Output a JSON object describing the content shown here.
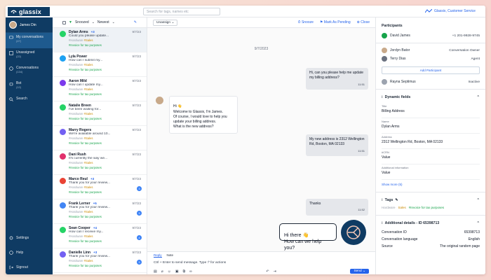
{
  "app": {
    "name": "glassix",
    "account": "Glassix, Customer Service"
  },
  "search": {
    "placeholder": "Search for tags, names etc"
  },
  "sidebar": {
    "user": "James Din",
    "items": [
      {
        "label": "My conversations",
        "count": "(47)"
      },
      {
        "label": "Unassigned",
        "count": "(22)"
      },
      {
        "label": "Conversations",
        "count": "(134)"
      },
      {
        "label": "Bot",
        "count": "(12)"
      },
      {
        "label": "Search",
        "count": ""
      }
    ],
    "bottom": [
      {
        "label": "Settings"
      },
      {
        "label": "Help"
      },
      {
        "label": "Signout"
      }
    ]
  },
  "list": {
    "filter": "Snoozed",
    "sort": "Newest",
    "conversations": [
      {
        "name": "Dylan Arms",
        "plus": "+3",
        "date": "9/7/23",
        "preview": "Could you please update...",
        "tags": [
          "#Hardware",
          "#Sales",
          "#Invoice for tax purposes"
        ],
        "channel": "whatsapp",
        "color": "#25d366",
        "badge": ""
      },
      {
        "name": "Lyla Power",
        "plus": "",
        "date": "9/7/23",
        "preview": "How can I submit my...",
        "tags": [
          "#Hardware",
          "#Sales",
          "#Invoice for tax purposes"
        ],
        "channel": "twitter",
        "color": "#1da1f2",
        "badge": ""
      },
      {
        "name": "Aaron Mild",
        "plus": "",
        "date": "9/7/23",
        "preview": "How can I update my...",
        "tags": [
          "#Hardware",
          "#Sales",
          "#Invoice for tax purposes"
        ],
        "channel": "messenger",
        "color": "#7c3aed",
        "badge": ""
      },
      {
        "name": "Natalie Breen",
        "plus": "",
        "date": "9/7/23",
        "preview": "I've been waiting for...",
        "tags": [
          "#Hardware",
          "#Sales",
          "#Invoice for tax purposes"
        ],
        "channel": "whatsapp",
        "color": "#25d366",
        "badge": ""
      },
      {
        "name": "Marry Rogers",
        "plus": "",
        "date": "9/7/23",
        "preview": "We're available around 10...",
        "tags": [
          "#Hardware",
          "#Sales",
          "#Invoice for tax purposes"
        ],
        "channel": "viber",
        "color": "#7360f2",
        "badge": ""
      },
      {
        "name": "Dani Rush",
        "plus": "",
        "date": "9/7/23",
        "preview": "It's currently the way we...",
        "tags": [
          "#Hardware",
          "#Sales",
          "#Invoice for tax purposes"
        ],
        "channel": "instagram",
        "color": "#e1306c",
        "badge": ""
      },
      {
        "name": "Marco Reul",
        "plus": "+3",
        "date": "9/7/23",
        "preview": "Thank you for your review...",
        "tags": [
          "#Hardware",
          "#Sales",
          "#Invoice for tax purposes"
        ],
        "channel": "google",
        "color": "#ea4335",
        "badge": "3"
      },
      {
        "name": "Frank Lerner",
        "plus": "+5",
        "date": "9/7/23",
        "preview": "Thank you for your review...",
        "tags": [
          "#Hardware",
          "#Sales",
          "#Invoice for tax purposes"
        ],
        "channel": "google",
        "color": "#4285f4",
        "badge": "3"
      },
      {
        "name": "Sean Cooper",
        "plus": "+4",
        "date": "9/7/23",
        "preview": "How can I receive my...",
        "tags": [
          "#Hardware",
          "#Sales",
          "#Invoice for tax purposes"
        ],
        "channel": "whatsapp",
        "color": "#25d366",
        "badge": "4"
      },
      {
        "name": "Danielle Linn",
        "plus": "+3",
        "date": "9/7/23",
        "preview": "Thank you for your review...",
        "tags": [
          "#Hardware",
          "#Sales",
          "#Invoice for tax purposes"
        ],
        "channel": "viber",
        "color": "#7360f2",
        "badge": "3"
      }
    ]
  },
  "chat": {
    "assign": "Unassign",
    "actions": [
      "Snooze",
      "Mark As Pending",
      "Close"
    ],
    "date": "9/7/2023",
    "messages": [
      {
        "dir": "in",
        "text": "Hi, can you please help me update my billing address?",
        "time": "11:51"
      },
      {
        "dir": "out",
        "text": "Hi 👋\nWelcome to Glassix, I'm James.\nOf course, I would love to help you update your billing address.\nWhat is the new address?",
        "time": ""
      },
      {
        "dir": "in",
        "text": "My new address is 2312 Wellington Rd, Boston, MA 02133",
        "time": "11:51"
      },
      {
        "dir": "in",
        "text": "Thanks",
        "time": "11:52"
      }
    ],
    "composer": {
      "tab_reply": "Reply",
      "tab_note": "Note",
      "placeholder": "Ctrl + Enter to send message. Type '/' for actions",
      "send": "Send"
    }
  },
  "widget": {
    "text": "Hi there 👋\nHow can we help you?"
  },
  "participants": {
    "title": "Participants",
    "rows": [
      {
        "name": "David James",
        "info": "+1 201-9928-9745"
      },
      {
        "name": "Jordyn Bator",
        "info": "Conversation Owner"
      },
      {
        "name": "Terry Dias",
        "info": "Agent"
      },
      {
        "name": "Rayna Septimus",
        "info": "Inactive"
      }
    ],
    "add": "Add Participant"
  },
  "dynamic": {
    "title": "Dynamic fields",
    "fields": [
      {
        "label": "Title",
        "value": "Billing Address"
      },
      {
        "label": "Name",
        "value": "Dylan Arms"
      },
      {
        "label": "Address",
        "value": "2312 Wellington Rd, Boston, MA 02133"
      },
      {
        "label": "#CRN",
        "value": "Value"
      },
      {
        "label": "Additional information",
        "value": "Value"
      }
    ],
    "more": "Show more (5)"
  },
  "tags": {
    "title": "Tags",
    "items": [
      "Hardware",
      "Sales",
      "#Invoice for tax purposes"
    ]
  },
  "details": {
    "title": "Additional details - ID 65398713",
    "rows": [
      {
        "k": "Conversation ID",
        "v": "65398713"
      },
      {
        "k": "Conversation language",
        "v": "English"
      },
      {
        "k": "Source",
        "v": "The original random page"
      }
    ]
  }
}
